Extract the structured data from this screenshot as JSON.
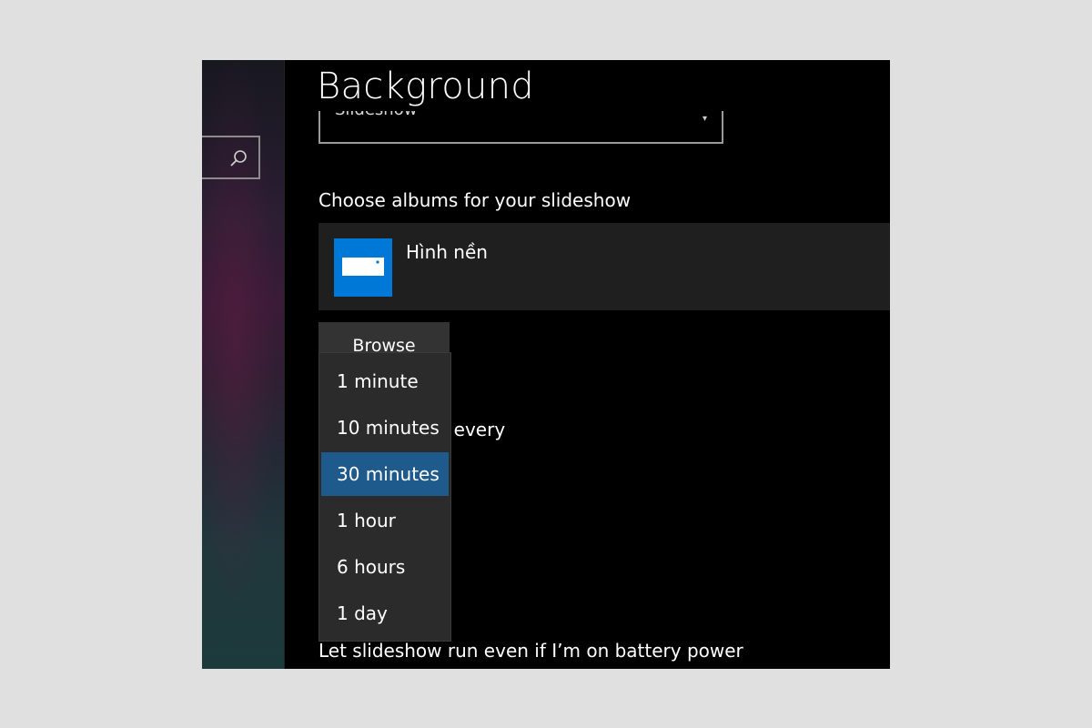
{
  "window": {
    "title": "Background"
  },
  "search": {
    "icon": "search-icon"
  },
  "background_dropdown": {
    "value": "Slideshow",
    "icon": "chevron-down-icon"
  },
  "albums": {
    "label": "Choose albums for your slideshow",
    "items": [
      {
        "name": "Hình nền",
        "icon": "folder-icon",
        "tile_color": "#0078d7"
      }
    ],
    "browse_label": "Browse"
  },
  "change_picture": {
    "label_visible": "e every"
  },
  "interval_menu": {
    "options": [
      "1 minute",
      "10 minutes",
      "30 minutes",
      "1 hour",
      "6 hours",
      "1 day"
    ],
    "selected": "30 minutes",
    "selected_color": "#1e5a8c"
  },
  "battery": {
    "label": "Let slideshow run even if I’m on battery power"
  }
}
